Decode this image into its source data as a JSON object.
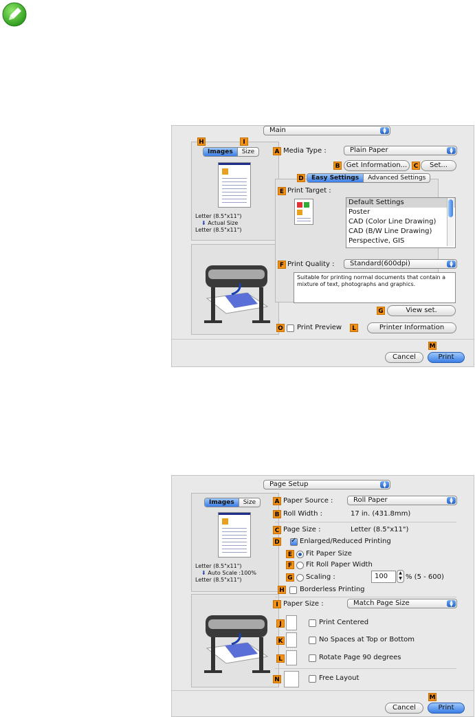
{
  "colors": {
    "label_badge": "#f39016",
    "accent_blue": "#3b7ee6",
    "dialog_bg": "#e9e9e9"
  },
  "note_icon": "pencil-note-icon",
  "dialog1": {
    "section_popup": "Main",
    "tabs": [
      "Images",
      "Size"
    ],
    "preview_text": {
      "line1": "Letter (8.5\"x11\")",
      "line2": "Actual Size",
      "line3": "Letter (8.5\"x11\")"
    },
    "media_type_label": "Media Type :",
    "media_type_value": "Plain Paper",
    "get_info_button": "Get Information...",
    "set_button": "Set...",
    "settings_tabs": [
      "Easy Settings",
      "Advanced Settings"
    ],
    "print_target_label": "Print Target :",
    "print_target_items": [
      "Default Settings",
      "Poster",
      "CAD (Color Line Drawing)",
      "CAD (B/W Line Drawing)",
      "Perspective, GIS"
    ],
    "print_quality_label": "Print Quality :",
    "print_quality_value": "Standard(600dpi)",
    "description": "Suitable for printing normal documents that contain a mixture of text, photographs and graphics.",
    "view_set_button": "View set.",
    "print_preview_label": "Print Preview",
    "printer_info_button": "Printer Information",
    "cancel_button": "Cancel",
    "print_button": "Print",
    "badges": {
      "A": "A",
      "B": "B",
      "C": "C",
      "D": "D",
      "E": "E",
      "F": "F",
      "G": "G",
      "H": "H",
      "I": "I",
      "L": "L",
      "M": "M",
      "O": "O"
    }
  },
  "dialog2": {
    "section_popup": "Page Setup",
    "tabs": [
      "Images",
      "Size"
    ],
    "preview_text": {
      "line1": "Letter (8.5\"x11\")",
      "line2": "Auto Scale :100%",
      "line3": "Letter (8.5\"x11\")"
    },
    "paper_source_label": "Paper Source :",
    "paper_source_value": "Roll Paper",
    "roll_width_label": "Roll Width :",
    "roll_width_value": "17 in. (431.8mm)",
    "page_size_label": "Page Size :",
    "page_size_value": "Letter (8.5\"x11\")",
    "enlarged_label": "Enlarged/Reduced Printing",
    "fit_paper_label": "Fit Paper Size",
    "fit_roll_label": "Fit Roll Paper Width",
    "scaling_label": "Scaling :",
    "scaling_value": "100",
    "scaling_range": "% (5 - 600)",
    "borderless_label": "Borderless Printing",
    "paper_size_label": "Paper Size :",
    "paper_size_value": "Match Page Size",
    "print_centered_label": "Print Centered",
    "no_spaces_label": "No Spaces at Top or Bottom",
    "rotate_label": "Rotate Page 90 degrees",
    "free_layout_label": "Free Layout",
    "cancel_button": "Cancel",
    "print_button": "Print",
    "badges": {
      "A": "A",
      "B": "B",
      "C": "C",
      "D": "D",
      "E": "E",
      "F": "F",
      "G": "G",
      "H": "H",
      "I": "I",
      "J": "J",
      "K": "K",
      "L": "L",
      "M": "M",
      "N": "N"
    }
  }
}
